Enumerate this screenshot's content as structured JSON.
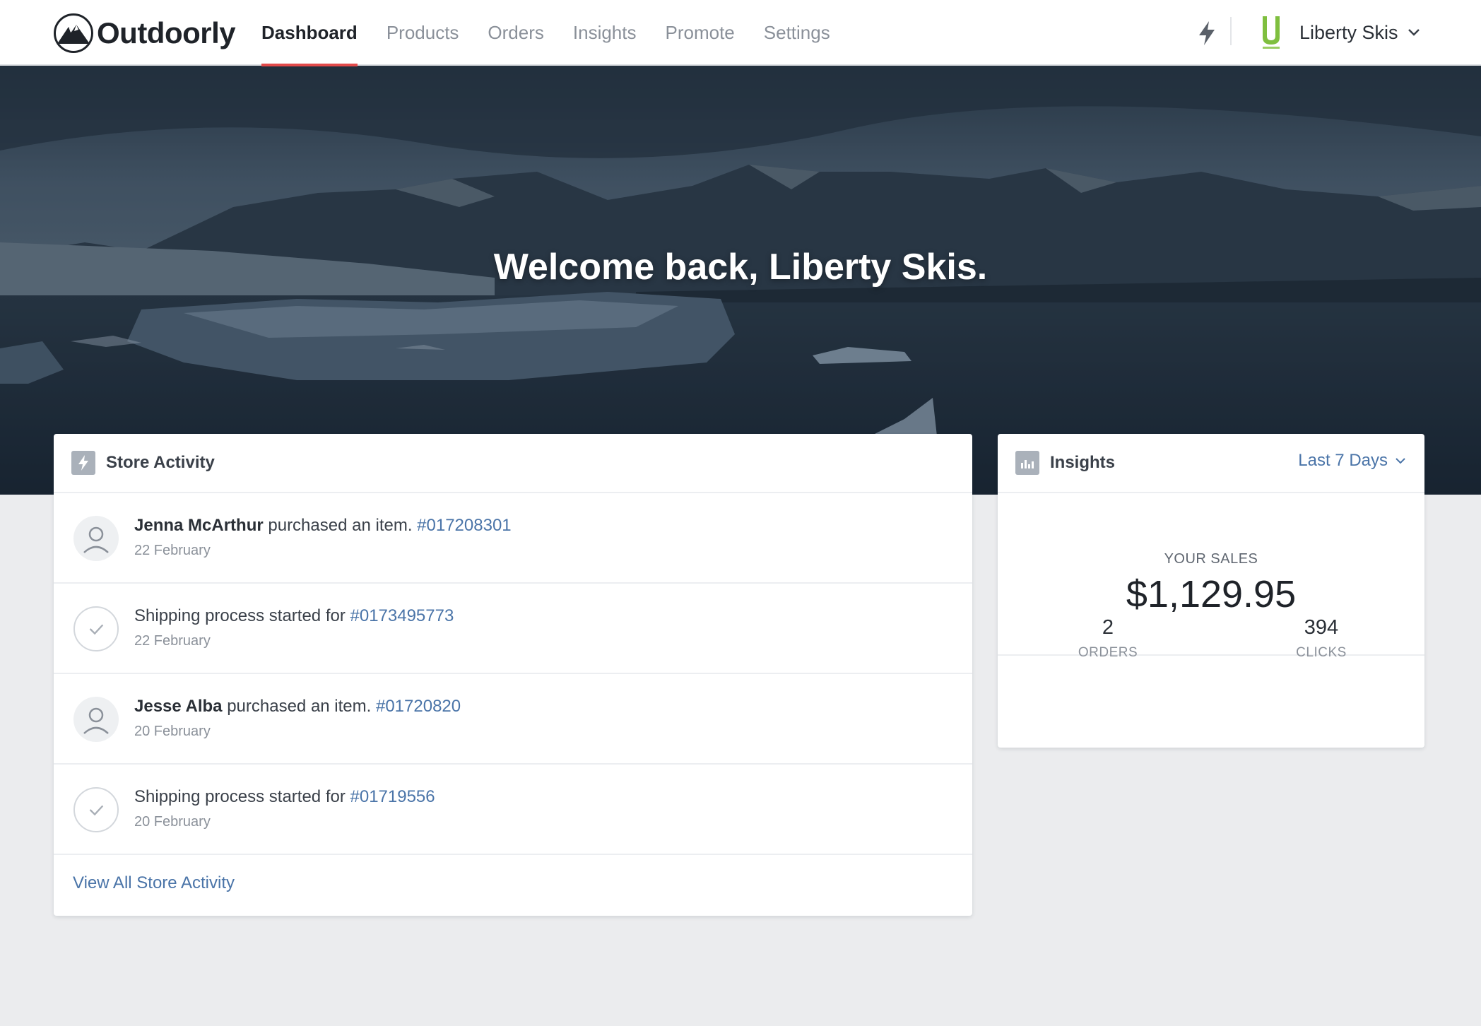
{
  "app": {
    "brand": "Outdoorly"
  },
  "nav": {
    "items": [
      {
        "label": "Dashboard",
        "active": true
      },
      {
        "label": "Products",
        "active": false
      },
      {
        "label": "Orders",
        "active": false
      },
      {
        "label": "Insights",
        "active": false
      },
      {
        "label": "Promote",
        "active": false
      },
      {
        "label": "Settings",
        "active": false
      }
    ],
    "active_underline_color": "#e24a4a"
  },
  "account": {
    "store_name": "Liberty Skis",
    "store_logo_color": "#7fbf3f"
  },
  "hero": {
    "title": "Welcome back, Liberty Skis."
  },
  "activity": {
    "title": "Store Activity",
    "items": [
      {
        "type": "purchase",
        "name": "Jenna McArthur",
        "text": " purchased an item. ",
        "order": "#017208301",
        "date": "22 February"
      },
      {
        "type": "shipping",
        "name": "",
        "text": "Shipping process started for ",
        "order": "#0173495773",
        "date": "22 February"
      },
      {
        "type": "purchase",
        "name": "Jesse Alba",
        "text": " purchased an item. ",
        "order": "#01720820",
        "date": "20 February"
      },
      {
        "type": "shipping",
        "name": "",
        "text": "Shipping process started for ",
        "order": "#01719556",
        "date": "20 February"
      }
    ],
    "view_all": "View All Store Activity"
  },
  "insights": {
    "title": "Insights",
    "range": "Last 7 Days",
    "sales_label": "YOUR SALES",
    "sales_value": "$1,129.95",
    "orders_value": "2",
    "orders_label": "ORDERS",
    "clicks_value": "394",
    "clicks_label": "CLICKS"
  },
  "colors": {
    "link": "#4a74a8",
    "page_bg": "#ebecee"
  }
}
